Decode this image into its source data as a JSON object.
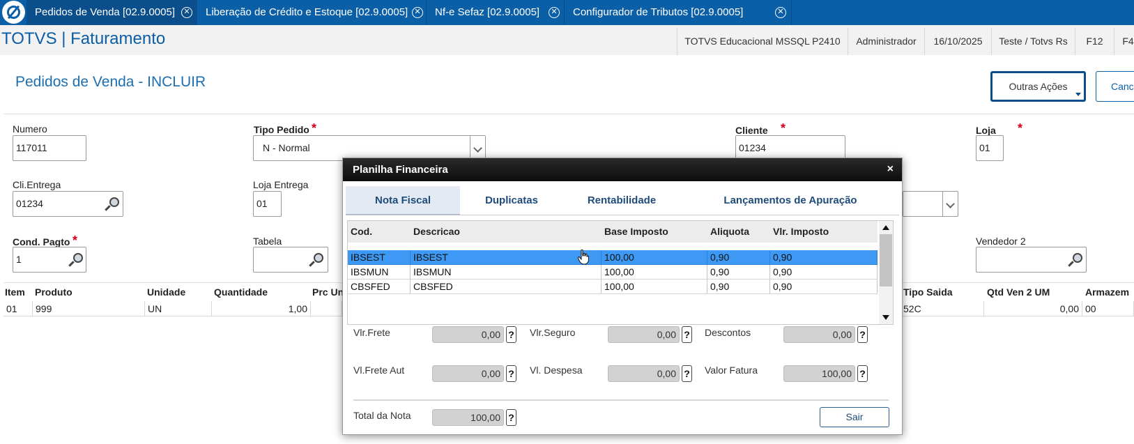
{
  "tabs": [
    {
      "label": "Pedidos de Venda [02.9.0005]",
      "active": true
    },
    {
      "label": "Liberação de Crédito e Estoque [02.9.0005]",
      "active": false
    },
    {
      "label": "Nf-e Sefaz [02.9.0005]",
      "active": false
    },
    {
      "label": "Configurador de Tributos [02.9.0005]",
      "active": false
    }
  ],
  "header": {
    "app_title": "TOTVS | Faturamento",
    "environment": "TOTVS Educacional MSSQL P2410",
    "user": "Administrador",
    "date": "16/10/2025",
    "company": "Teste / Totvs Rs",
    "f12": "F12",
    "f4": "F4"
  },
  "page": {
    "title": "Pedidos de Venda - INCLUIR",
    "outras_acoes": "Outras Ações",
    "cancelar": "Cancelar"
  },
  "form": {
    "numero_label": "Numero",
    "numero_value": "117011",
    "tipo_pedido_label": "Tipo Pedido",
    "tipo_pedido_value": "N - Normal",
    "cliente_label": "Cliente",
    "cliente_value": "01234",
    "loja_label": "Loja",
    "loja_value": "01",
    "cli_entrega_label": "Cli.Entrega",
    "cli_entrega_value": "01234",
    "loja_entrega_label": "Loja Entrega",
    "loja_entrega_value": "01",
    "cond_pagto_label": "Cond. Pagto",
    "cond_pagto_value": "1",
    "tabela_label": "Tabela",
    "tabela_value": "",
    "vendedor2_label": "Vendedor 2",
    "vendedor2_value": "",
    "required_mark": "*"
  },
  "grid": {
    "headers": [
      "Item",
      "Produto",
      "Unidade",
      "Quantidade",
      "Prc Un",
      "Tipo Saida",
      "Qtd Ven 2 UM",
      "Armazem"
    ],
    "row": {
      "item": "01",
      "produto": "999",
      "unidade": "UN",
      "quantidade": "1,00",
      "tipo_saida": "52C",
      "qtd_ven_2um": "0,00",
      "armazem": "00"
    }
  },
  "modal": {
    "title": "Planilha Financeira",
    "close": "×",
    "tabs": [
      "Nota Fiscal",
      "Duplicatas",
      "Rentabilidade",
      "Lançamentos de Apuração"
    ],
    "active_tab": "Nota Fiscal",
    "columns": [
      "Cod.",
      "Descricao",
      "Base Imposto",
      "Aliquota",
      "Vlr. Imposto"
    ],
    "rows": [
      [
        "IBSEST",
        "IBSEST",
        "100,00",
        "0,90",
        "0,90"
      ],
      [
        "IBSMUN",
        "IBSMUN",
        "100,00",
        "0,90",
        "0,90"
      ],
      [
        "CBSFED",
        "CBSFED",
        "100,00",
        "0,90",
        "0,90"
      ]
    ],
    "totals": {
      "vlr_frete_label": "Vlr.Frete",
      "vlr_frete": "0,00",
      "vlr_seguro_label": "Vlr.Seguro",
      "vlr_seguro": "0,00",
      "descontos_label": "Descontos",
      "descontos": "0,00",
      "vl_frete_aut_label": "Vl.Frete Aut",
      "vl_frete_aut": "0,00",
      "vl_despesa_label": "Vl. Despesa",
      "vl_despesa": "0,00",
      "valor_fatura_label": "Valor Fatura",
      "valor_fatura": "100,00",
      "total_nota_label": "Total da Nota",
      "total_nota": "100,00"
    },
    "help": "?",
    "sair": "Sair"
  },
  "colors": {
    "tabbar": "#0a5fa7",
    "accent": "#0b5da6",
    "selected_row": "#3d99f3",
    "required": "#d6001c"
  }
}
